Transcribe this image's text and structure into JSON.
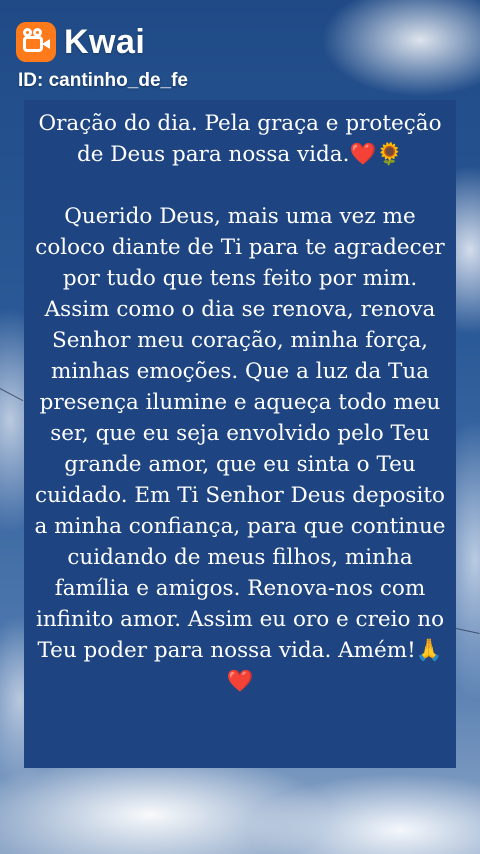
{
  "header": {
    "brand_name": "Kwai",
    "user_id": "ID: cantinho_de_fe"
  },
  "post": {
    "title_text": "Oração do dia. Pela graça e proteção de Deus para nossa vida.",
    "title_emoji_1": "❤️",
    "title_emoji_2": "🌻",
    "body_text": "Querido Deus, mais uma vez me coloco diante de Ti para te agradecer por tudo que tens feito por mim. Assim como o dia se renova, renova Senhor meu coração, minha força, minhas emoções. Que a luz da Tua presença ilumine e aqueça todo meu ser, que eu seja envolvido pelo Teu grande amor, que eu sinta o Teu cuidado. Em Ti Senhor Deus deposito a minha confiança, para que continue cuidando de meus filhos, minha família e amigos. Renova-nos com infinito amor. Assim eu oro e creio no Teu poder para nossa vida. Amém!",
    "end_emoji_1": "🙏",
    "end_emoji_2": "❤️"
  },
  "colors": {
    "card_background": "#1e4582",
    "brand_orange": "#ff7a1a",
    "text": "#ffffff",
    "heart": "#e11d2e"
  },
  "icons": {
    "app_logo": "kwai-camera-logo-icon"
  }
}
